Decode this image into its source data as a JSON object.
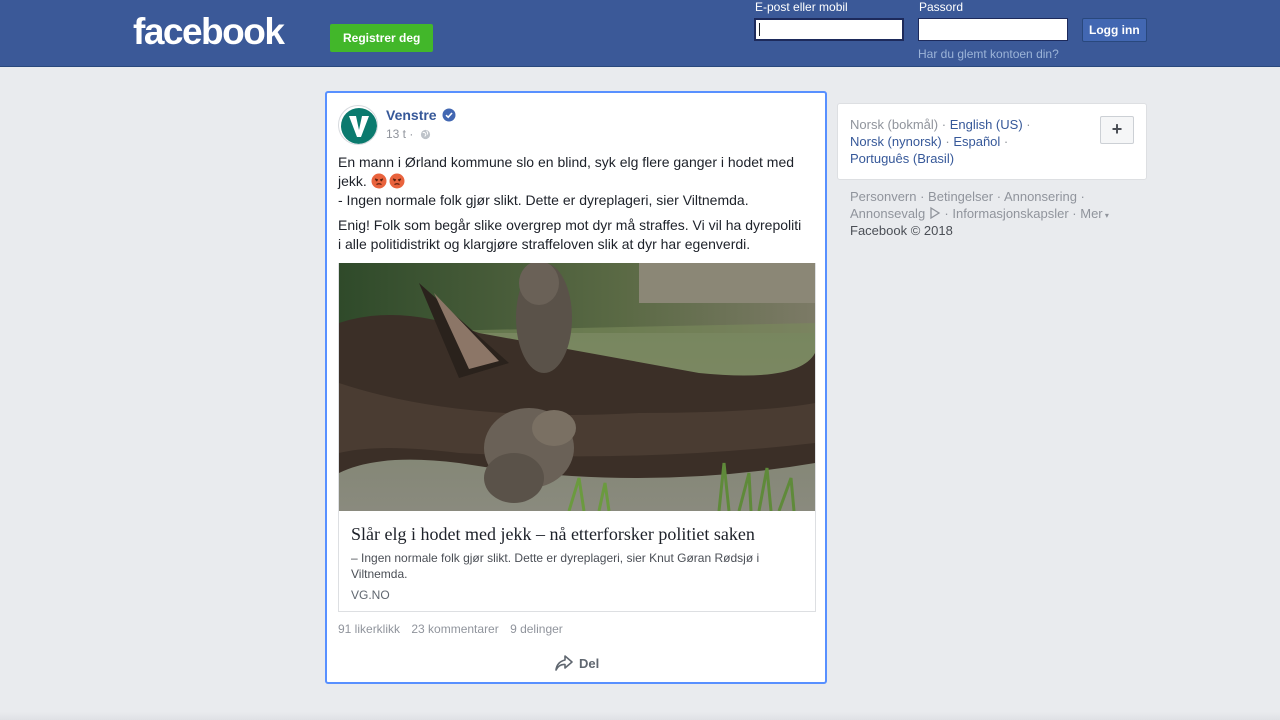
{
  "header": {
    "logo_text": "facebook",
    "register_label": "Registrer deg",
    "email_label": "E-post eller mobil",
    "password_label": "Passord",
    "login_label": "Logg inn",
    "forgot_label": "Har du glemt kontoen din?"
  },
  "post": {
    "page_name": "Venstre",
    "verified": true,
    "time": "13 t",
    "separator": " · ",
    "text_line1": "En mann i Ørland kommune slo en blind, syk elg flere ganger i hodet med jekk.",
    "text_line2": "- Ingen normale folk gjør slikt. Dette er dyreplageri, sier Viltnemda.",
    "text_para2": "Enig! Folk som begår slike overgrep mot dyr må straffes. Vi vil ha dyrepoliti i alle politidistrikt og klargjøre straffeloven slik at dyr har egenverdi.",
    "emojis": [
      "angry-face-icon",
      "angry-face-icon"
    ],
    "link": {
      "title": "Slår elg i hodet med jekk – nå etterforsker politiet saken",
      "description": "– Ingen normale folk gjør slikt. Dette er dyreplageri, sier Knut Gøran Rødsjø i Viltnemda.",
      "domain": "VG.NO"
    },
    "likes": "91 likerklikk",
    "comments": "23 kommentarer",
    "shares": "9 delinger",
    "share_label": "Del"
  },
  "sidebar": {
    "languages": {
      "current": "Norsk (bokmål)",
      "others": [
        "English (US)",
        "Norsk (nynorsk)",
        "Español",
        "Português (Brasil)"
      ],
      "add_label": "+"
    },
    "footer_links": [
      "Personvern",
      "Betingelser",
      "Annonsering",
      "Annonsevalg",
      "Informasjonskapsler",
      "Mer"
    ],
    "copyright": "Facebook © 2018"
  },
  "colors": {
    "brand_blue": "#3b5998",
    "register_green": "#42b72a",
    "link_blue": "#365899",
    "highlight_border": "#5890ff"
  }
}
